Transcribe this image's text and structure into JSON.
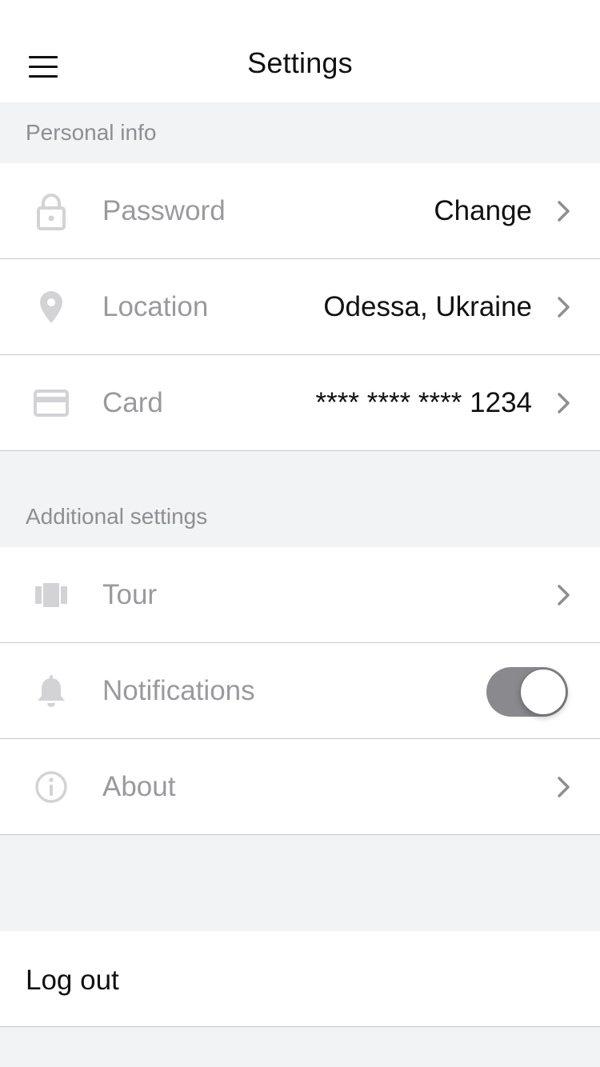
{
  "header": {
    "title": "Settings"
  },
  "sections": {
    "personal": {
      "label": "Personal info",
      "items": {
        "password": {
          "label": "Password",
          "value": "Change",
          "icon": "lock-icon"
        },
        "location": {
          "label": "Location",
          "value": "Odessa, Ukraine",
          "icon": "location-pin-icon"
        },
        "card": {
          "label": "Card",
          "value": "**** **** **** 1234",
          "icon": "credit-card-icon"
        }
      }
    },
    "additional": {
      "label": "Additional settings",
      "items": {
        "tour": {
          "label": "Tour",
          "icon": "carousel-icon"
        },
        "notifications": {
          "label": "Notifications",
          "icon": "bell-icon",
          "enabled": true
        },
        "about": {
          "label": "About",
          "icon": "info-icon"
        }
      }
    }
  },
  "logout": {
    "label": "Log out"
  },
  "colors": {
    "background": "#f2f3f5",
    "row": "#ffffff",
    "icon": "#cfcfd2",
    "label": "#9a9a9e",
    "value": "#111111",
    "toggle_track": "#8a8a8e"
  }
}
